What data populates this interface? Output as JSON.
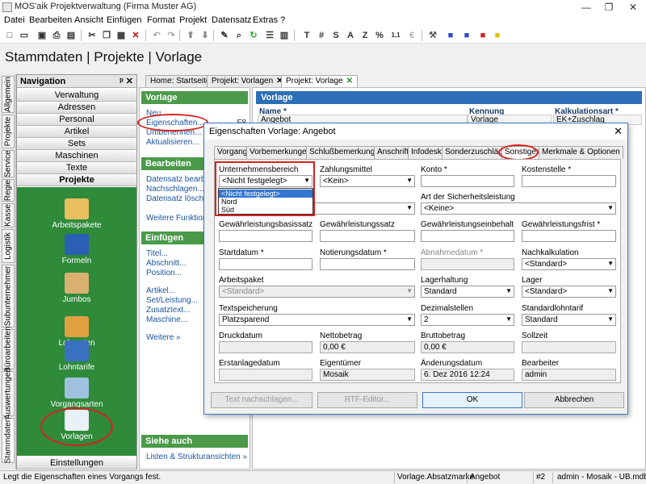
{
  "window": {
    "title": "MOS'aik Projektverwaltung (Firma Muster AG)",
    "buttons": [
      "—",
      "❐",
      "✕"
    ]
  },
  "menu": [
    "Datei",
    "Bearbeiten",
    "Ansicht",
    "Einfügen",
    "Format",
    "Projekt",
    "Datensatz",
    "Extras",
    "?"
  ],
  "toolbar": {
    "letters": [
      "T",
      "#",
      "S",
      "A",
      "Z",
      "%",
      "1,1",
      "€"
    ]
  },
  "page_title": "Stammdaten | Projekte | Vorlage",
  "vertical_tabs": [
    "Allgemein",
    "Projekte",
    "Service",
    "Regie",
    "Kasse",
    "Logistik",
    "Subunternehmer",
    "Büroarbeiten",
    "Auswertungen",
    "Stammdaten"
  ],
  "navigation": {
    "title": "Navigation",
    "pin": "ᵖ ✕",
    "items": [
      "Verwaltung",
      "Adressen",
      "Personal",
      "Artikel",
      "Sets",
      "Maschinen",
      "Texte",
      "Projekte"
    ],
    "icons": [
      {
        "label": "Arbeitspakete",
        "icon": "workpackage-icon"
      },
      {
        "label": "Formeln",
        "icon": "calculator-icon"
      },
      {
        "label": "Jumbos",
        "icon": "jumbo-icon"
      },
      {
        "label": "Lohnarten",
        "icon": "wage-icon"
      },
      {
        "label": "Lohntarife",
        "icon": "tariff-icon"
      },
      {
        "label": "Vorgangsarten",
        "icon": "process-icon"
      },
      {
        "label": "Vorlagen",
        "icon": "template-icon"
      }
    ],
    "settings": "Einstellungen"
  },
  "doc_tabs": [
    {
      "label": "Home: Startseite",
      "closable": false
    },
    {
      "label": "Projekt: Vorlagen",
      "closable": true
    },
    {
      "label": "Projekt: Vorlage",
      "closable": true
    }
  ],
  "task_pane": {
    "sections": [
      {
        "title": "Vorlage",
        "links": [
          "Neu...",
          "Eigenschaften...",
          "Umbenennen...",
          "Aktualisieren..."
        ],
        "hotkey": "F8"
      },
      {
        "title": "Bearbeiten",
        "links": [
          "Datensatz bearbeiten",
          "Nachschlagen...",
          "Datensatz löschen",
          "Weitere Funktionen"
        ],
        "hotkey": "*"
      },
      {
        "title": "Einfügen",
        "links": [
          "Titel...",
          "Abschnitt...",
          "Position...",
          "Artikel...",
          "Set/Leistung...",
          "Zusatztext...",
          "Maschine...",
          "Weitere »"
        ]
      },
      {
        "title": "Siehe auch",
        "links": [
          "Listen & Strukturansichten »"
        ]
      }
    ]
  },
  "main_form": {
    "header": "Vorlage",
    "name_label": "Name *",
    "name_value": "Angebot",
    "kennung_label": "Kennung",
    "kennung_value": "Vorlage",
    "kalk_label": "Kalkulationsart *",
    "kalk_value": "EK+Zuschlag"
  },
  "dialog": {
    "title": "Eigenschaften Vorlage: Angebot",
    "close": "✕",
    "tabs": [
      "Vorgang",
      "Vorbemerkungen",
      "Schlußbemerkungen",
      "Anschrift",
      "Infodesk",
      "Sonderzuschläge",
      "Sonstiges",
      "Merkmale & Optionen"
    ],
    "active_tab": "Sonstiges",
    "fields": {
      "unternehmensbereich": {
        "label": "Unternehmensbereich",
        "value": "<Nicht festgelegt>",
        "options": [
          "<Nicht festgelegt>",
          "Nord",
          "Süd"
        ]
      },
      "zahlungsmittel": {
        "label": "Zahlungsmittel",
        "value": "<Kein>"
      },
      "konto": {
        "label": "Konto *",
        "value": ""
      },
      "kostenstelle": {
        "label": "Kostenstelle *",
        "value": ""
      },
      "sicherheitsleistung": {
        "label": "Art der Sicherheitsleistung",
        "value": "<Keine>"
      },
      "gewaehr_basis": {
        "label": "Gewährleistungsbasissatz",
        "value": ""
      },
      "gewaehr_satz": {
        "label": "Gewährleistungssatz",
        "value": ""
      },
      "gewaehr_einbehalt": {
        "label": "Gewährleistungseinbehalt",
        "value": ""
      },
      "gewaehr_frist": {
        "label": "Gewährleistungsfrist *",
        "value": ""
      },
      "startdatum": {
        "label": "Startdatum *",
        "value": ""
      },
      "notierungsdatum": {
        "label": "Notierungsdatum *",
        "value": ""
      },
      "abnahmedatum": {
        "label": "Abnahmedatum *",
        "value": ""
      },
      "nachkalkulation": {
        "label": "Nachkalkulation",
        "value": "<Standard>"
      },
      "arbeitspaket": {
        "label": "Arbeitspaket",
        "value": "<Standard>"
      },
      "lagerhaltung": {
        "label": "Lagerhaltung",
        "value": "Standard"
      },
      "lager": {
        "label": "Lager",
        "value": "<Standard>"
      },
      "textspeicherung": {
        "label": "Textspeicherung",
        "value": "Platzsparend"
      },
      "dezimalstellen": {
        "label": "Dezimalstellen",
        "value": "2"
      },
      "standardlohntarif": {
        "label": "Standardlohntarif",
        "value": "Standard"
      },
      "druckdatum": {
        "label": "Druckdatum",
        "value": ""
      },
      "nettobetrag": {
        "label": "Nettobetrag",
        "value": "0,00 €"
      },
      "bruttobetrag": {
        "label": "Bruttobetrag",
        "value": "0,00 €"
      },
      "sollzeit": {
        "label": "Sollzeit",
        "value": ""
      },
      "erstanlagedatum": {
        "label": "Erstanlagedatum",
        "value": ""
      },
      "eigentuemer": {
        "label": "Eigentümer",
        "value": "Mosaik"
      },
      "aenderungsdatum": {
        "label": "Änderungsdatum",
        "value": "6. Dez 2016 12:24"
      },
      "bearbeiter": {
        "label": "Bearbeiter",
        "value": "admin"
      }
    },
    "buttons": {
      "text_lookup": "Text nachschlagen...",
      "rtf_editor": "RTF-Editor...",
      "ok": "OK",
      "cancel": "Abbrechen"
    }
  },
  "statusbar": {
    "message": "Legt die Eigenschaften eines Vorgangs fest.",
    "field": "Vorlage.Absatzmarke",
    "doc": "Angebot",
    "number": "#2",
    "user": "admin - Mosaik - UB.mdb"
  },
  "colors": {
    "nav_green": "#2f8a3a",
    "section_green": "#4a9a4a",
    "form_blue": "#2c6fb6",
    "highlight_red": "#d7211f",
    "selection_blue": "#3276d0"
  }
}
